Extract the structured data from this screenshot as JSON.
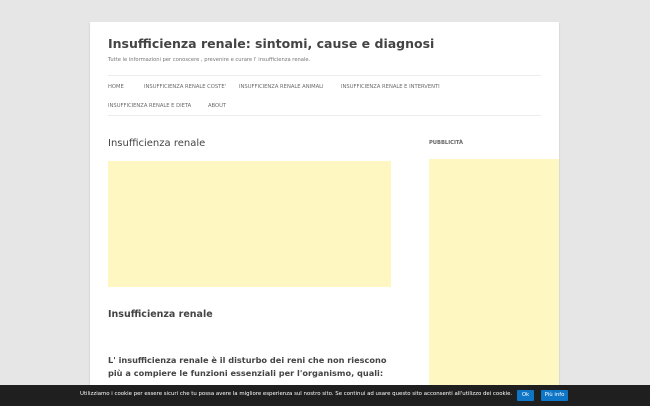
{
  "site": {
    "title": "Insufficienza renale: sintomi, cause e diagnosi",
    "description": "Tutte le informazioni per conoscere , prevenire e curare l' insufficienza renale."
  },
  "nav": {
    "items": [
      "HOME",
      "INSUFFICIENZA RENALE COSTE'",
      "INSUFFICIENZA RENALE ANIMALI",
      "INSUFFICIENZA RENALE E INTERVENTI",
      "INSUFFICIENZA RENALE E DIETA",
      "ABOUT"
    ]
  },
  "main": {
    "title": "Insufficienza renale",
    "article_heading": "Insufficienza renale",
    "article_paragraph": "L' insufficienza renale è il disturbo dei reni che non riescono più a compiere le funzioni essenziali per  l'organismo, quali:"
  },
  "sidebar": {
    "heading": "PUBBLICITÀ"
  },
  "cookie": {
    "text": "Utilizziamo i cookie per essere sicuri che tu possa avere la migliore esperienza sul nostro sito. Se continui ad usare questo sito acconsenti all'utilizzo dei cookie.",
    "ok_label": "Ok",
    "info_label": "Più info"
  },
  "colors": {
    "page_bg": "#e6e6e6",
    "ad_bg": "#fff7c2",
    "cookie_bar_bg": "#1f1f1f",
    "button_bg": "#0f76c7"
  }
}
